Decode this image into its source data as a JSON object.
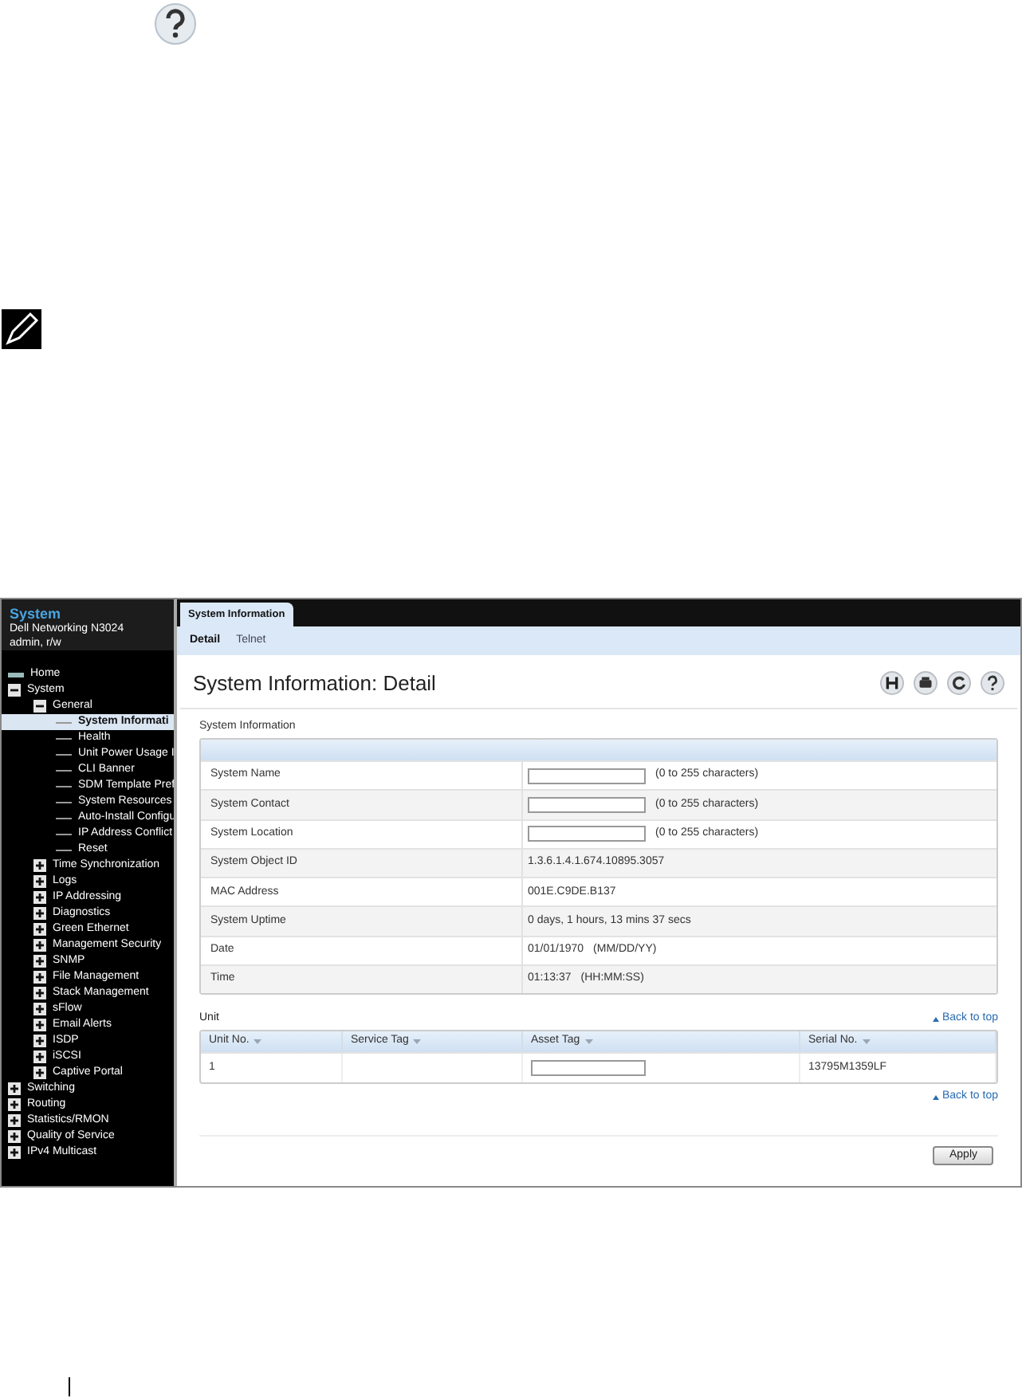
{
  "sidebar": {
    "title": "System",
    "device": "Dell Networking N3024",
    "user": "admin, r/w",
    "tree": [
      {
        "label": "Home",
        "kind": "home",
        "selected": false
      },
      {
        "label": "System",
        "kind": "folder",
        "expanded": true,
        "selected": false,
        "children": [
          {
            "label": "General",
            "kind": "folder",
            "expanded": true,
            "selected": false,
            "children": [
              {
                "label": "System Informati",
                "kind": "leaf",
                "selected": true
              },
              {
                "label": "Health",
                "kind": "leaf",
                "selected": false
              },
              {
                "label": "Unit Power Usage I",
                "kind": "leaf",
                "selected": false
              },
              {
                "label": "CLI Banner",
                "kind": "leaf",
                "selected": false
              },
              {
                "label": "SDM Template Pref",
                "kind": "leaf",
                "selected": false
              },
              {
                "label": "System Resources",
                "kind": "leaf",
                "selected": false
              },
              {
                "label": "Auto-Install Configu",
                "kind": "leaf",
                "selected": false
              },
              {
                "label": "IP Address Conflict",
                "kind": "leaf",
                "selected": false
              },
              {
                "label": "Reset",
                "kind": "leaf",
                "selected": false
              }
            ]
          },
          {
            "label": "Time Synchronization",
            "kind": "folder",
            "expanded": false,
            "selected": false
          },
          {
            "label": "Logs",
            "kind": "folder",
            "expanded": false,
            "selected": false
          },
          {
            "label": "IP Addressing",
            "kind": "folder",
            "expanded": false,
            "selected": false
          },
          {
            "label": "Diagnostics",
            "kind": "folder",
            "expanded": false,
            "selected": false
          },
          {
            "label": "Green Ethernet",
            "kind": "folder",
            "expanded": false,
            "selected": false
          },
          {
            "label": "Management Security",
            "kind": "folder",
            "expanded": false,
            "selected": false
          },
          {
            "label": "SNMP",
            "kind": "folder",
            "expanded": false,
            "selected": false
          },
          {
            "label": "File Management",
            "kind": "folder",
            "expanded": false,
            "selected": false
          },
          {
            "label": "Stack Management",
            "kind": "folder",
            "expanded": false,
            "selected": false
          },
          {
            "label": "sFlow",
            "kind": "folder",
            "expanded": false,
            "selected": false
          },
          {
            "label": "Email Alerts",
            "kind": "folder",
            "expanded": false,
            "selected": false
          },
          {
            "label": "ISDP",
            "kind": "folder",
            "expanded": false,
            "selected": false
          },
          {
            "label": "iSCSI",
            "kind": "folder",
            "expanded": false,
            "selected": false
          },
          {
            "label": "Captive Portal",
            "kind": "folder",
            "expanded": false,
            "selected": false
          }
        ]
      },
      {
        "label": "Switching",
        "kind": "folder",
        "expanded": false,
        "selected": false
      },
      {
        "label": "Routing",
        "kind": "folder",
        "expanded": false,
        "selected": false
      },
      {
        "label": "Statistics/RMON",
        "kind": "folder",
        "expanded": false,
        "selected": false
      },
      {
        "label": "Quality of Service",
        "kind": "folder",
        "expanded": false,
        "selected": false
      },
      {
        "label": "IPv4 Multicast",
        "kind": "folder",
        "expanded": false,
        "selected": false
      }
    ]
  },
  "tabs": [
    {
      "label": "System Information",
      "selected": true
    }
  ],
  "subtabs": [
    {
      "label": "Detail",
      "selected": true
    },
    {
      "label": "Telnet",
      "selected": false
    }
  ],
  "title": "System Information: Detail",
  "system_info": {
    "heading": "System Information",
    "rows": [
      {
        "label": "System Name",
        "kind": "input",
        "hint": "(0 to 255 characters)"
      },
      {
        "label": "System Contact",
        "kind": "input",
        "hint": "(0 to 255 characters)"
      },
      {
        "label": "System Location",
        "kind": "input",
        "hint": "(0 to 255 characters)"
      },
      {
        "label": "System Object ID",
        "kind": "text",
        "value": "1.3.6.1.4.1.674.10895.3057"
      },
      {
        "label": "MAC Address",
        "kind": "text",
        "value": "001E.C9DE.B137"
      },
      {
        "label": "System Uptime",
        "kind": "text",
        "value": "0 days, 1 hours, 13 mins 37 secs"
      },
      {
        "label": "Date",
        "kind": "text",
        "value": "01/01/1970",
        "hint": "(MM/DD/YY)"
      },
      {
        "label": "Time",
        "kind": "text",
        "value": "01:13:37",
        "hint": "(HH:MM:SS)"
      }
    ]
  },
  "unit": {
    "heading": "Unit",
    "back_to_top": "Back to top",
    "columns": [
      "Unit No.",
      "Service Tag",
      "Asset Tag",
      "Serial No."
    ],
    "rows": [
      [
        {
          "kind": "text",
          "text": "1"
        },
        {
          "kind": "empty"
        },
        {
          "kind": "input"
        },
        {
          "kind": "text",
          "text": "13795M1359LF"
        }
      ]
    ],
    "back_to_top_bottom": "Back to top"
  },
  "apply_button": "Apply"
}
